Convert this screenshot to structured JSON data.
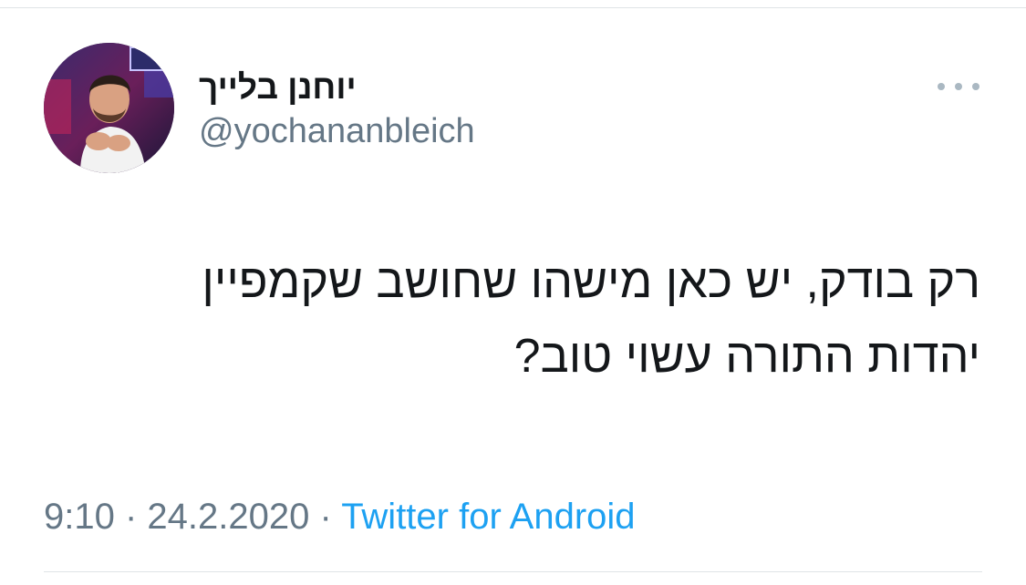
{
  "tweet": {
    "author_name": "יוחנן בלייך",
    "author_handle": "@yochananbleich",
    "text_lines": [
      "רק בודק, יש כאן מישהו שחושב שקמפיין",
      "יהדות התורה עשוי טוב?"
    ],
    "time": "9:10",
    "separator": " · ",
    "date": "24.2.2020",
    "source": "Twitter for Android"
  },
  "icons": {
    "more": "more-options-icon",
    "avatar": "profile-photo"
  },
  "colors": {
    "text": "#14171a",
    "secondary": "#657786",
    "link": "#1da1f2",
    "divider": "#dfe3e6"
  }
}
